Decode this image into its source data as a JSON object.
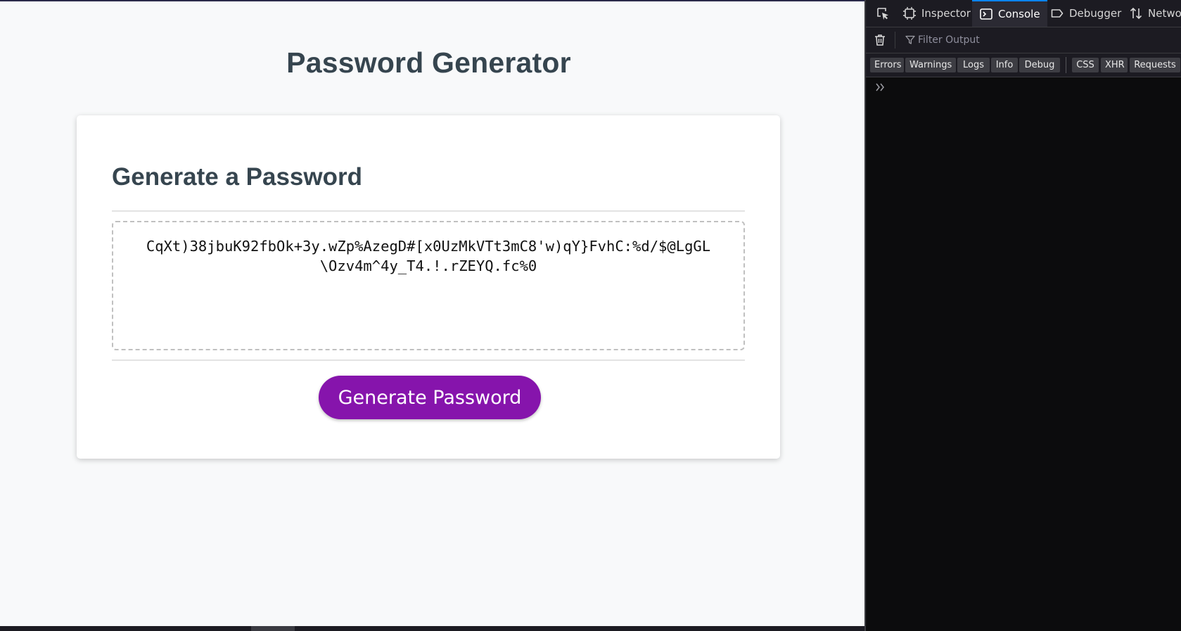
{
  "page": {
    "title": "Password Generator",
    "card_heading": "Generate a Password",
    "password": "CqXt)38jbuK92fbOk+3y.wZp%AzegD#[x0UzMkVTt3mC8'w)qY}FvhC:%d/$@LgGL\\Ozv4m^4y_T4.!.rZEYQ.fc%0",
    "generate_button": "Generate Password",
    "accent_color": "#8614ac"
  },
  "devtools": {
    "tabs": [
      {
        "label": "Inspector",
        "icon": "inspector-icon"
      },
      {
        "label": "Console",
        "icon": "console-icon",
        "selected": true
      },
      {
        "label": "Debugger",
        "icon": "debugger-icon"
      },
      {
        "label": "Networ",
        "icon": "network-icon"
      }
    ],
    "filter_placeholder": "Filter Output",
    "levels": [
      "Errors",
      "Warnings",
      "Logs",
      "Info",
      "Debug"
    ],
    "request_filters": [
      "CSS",
      "XHR",
      "Requests"
    ]
  }
}
